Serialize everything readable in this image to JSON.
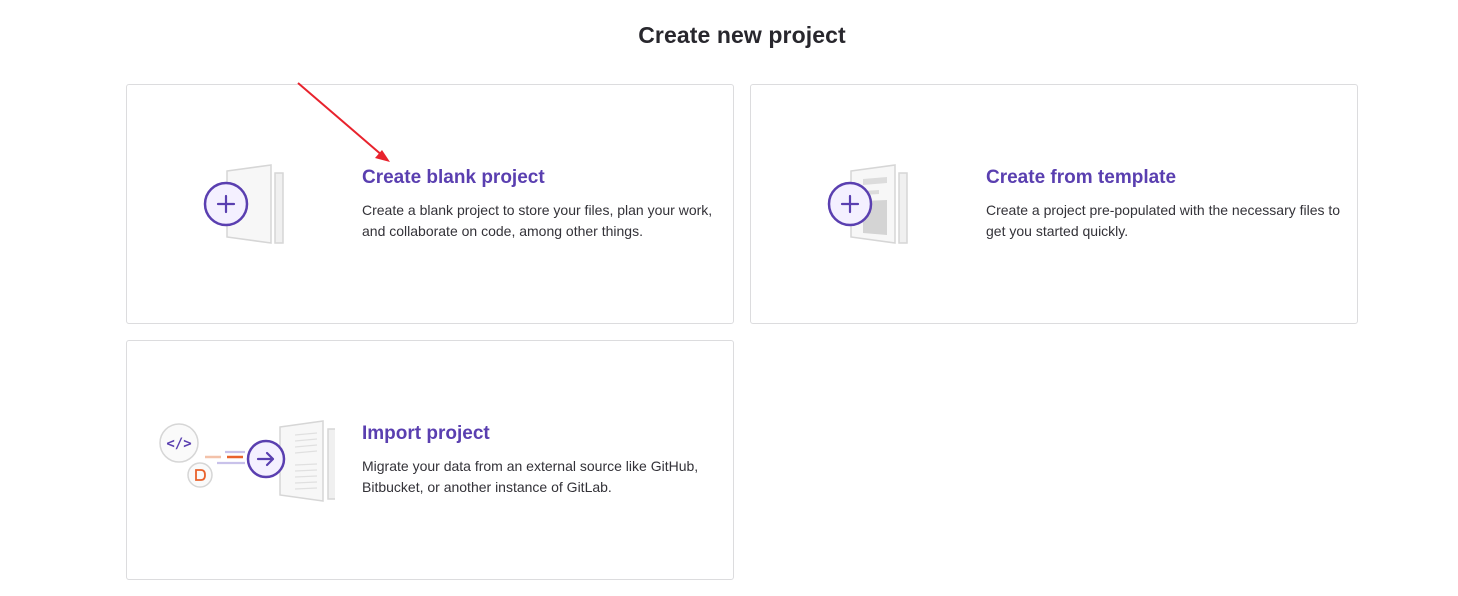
{
  "page": {
    "title": "Create new project"
  },
  "cards": [
    {
      "id": "blank",
      "title": "Create blank project",
      "description": "Create a blank project to store your files, plan your work, and collaborate on code, among other things.",
      "icon": "plus-document-icon"
    },
    {
      "id": "template",
      "title": "Create from template",
      "description": "Create a project pre-populated with the necessary files to get you started quickly.",
      "icon": "template-document-icon"
    },
    {
      "id": "import",
      "title": "Import project",
      "description": "Migrate your data from an external source like GitHub, Bitbucket, or another instance of GitLab.",
      "icon": "import-document-icon"
    }
  ],
  "colors": {
    "accent": "#5a3fb0",
    "accent_light": "#f4f0ff",
    "border": "#dcdcde",
    "annotation_arrow": "#e8232d",
    "import_orange": "#e9622c"
  }
}
